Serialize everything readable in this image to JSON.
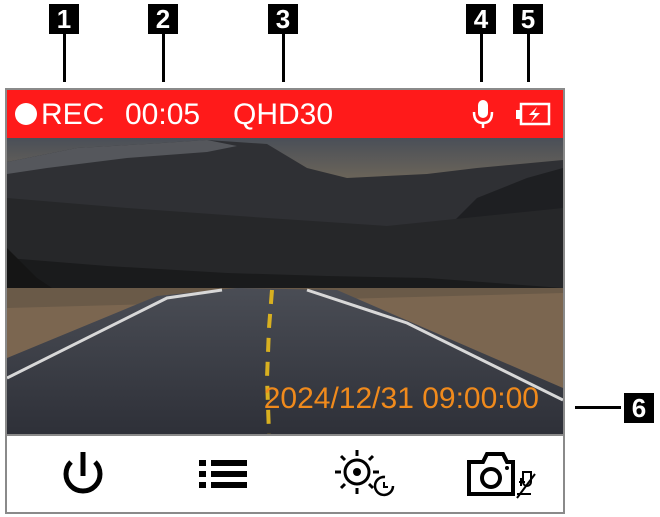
{
  "status_bar": {
    "rec_label": "REC",
    "recording_time": "00:05",
    "resolution": "QHD30",
    "microphone_icon": "microphone-icon",
    "battery_icon": "battery-charging-icon",
    "background_color": "#ff1a1a"
  },
  "camera_view": {
    "timestamp": "2024/12/31  09:00:00",
    "timestamp_color": "#f08a1c"
  },
  "controls": [
    {
      "icon": "power-icon"
    },
    {
      "icon": "menu-list-icon"
    },
    {
      "icon": "brightness-timer-icon"
    },
    {
      "icon": "camera-snapshot-icon"
    }
  ],
  "callouts": [
    "1",
    "2",
    "3",
    "4",
    "5",
    "6"
  ]
}
